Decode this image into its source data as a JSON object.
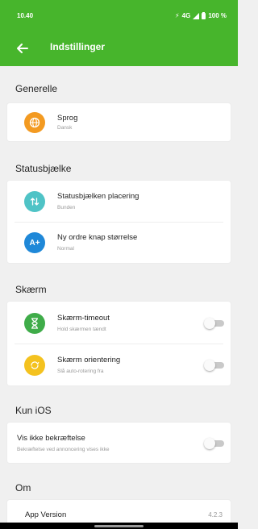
{
  "status_bar": {
    "time": "10.40",
    "network": "4G",
    "battery": "100 %"
  },
  "header": {
    "title": "Indstillinger",
    "back_icon": "arrow-left-icon",
    "color": "#47b52c"
  },
  "sections": {
    "general": {
      "title": "Generelle",
      "items": [
        {
          "label": "Sprog",
          "value": "Dansk",
          "icon": "globe-icon",
          "icon_color": "#f39a21"
        }
      ]
    },
    "statusbar": {
      "title": "Statusbjælke",
      "items": [
        {
          "label": "Statusbjælken placering",
          "value": "Bunden",
          "icon": "swap-vertical-icon",
          "icon_color": "#4fc3c6"
        },
        {
          "label": "Ny ordre knap størrelse",
          "value": "Normal",
          "icon": "font-size-increase-icon",
          "icon_color": "#1f88d8"
        }
      ]
    },
    "screen": {
      "title": "Skærm",
      "items": [
        {
          "label": "Skærm-timeout",
          "value": "Hold skærmen tændt",
          "icon": "hourglass-icon",
          "icon_color": "#3fac49",
          "toggle": false
        },
        {
          "label": "Skærm orientering",
          "value": "Slå auto-rotering fra",
          "icon": "rotate-screen-icon",
          "icon_color": "#f4c21f",
          "toggle": false
        }
      ]
    },
    "ios": {
      "title": "Kun iOS",
      "items": [
        {
          "label": "Vis ikke bekræftelse",
          "value": "Bekræftelse ved annoncering vises ikke",
          "toggle": false
        }
      ]
    },
    "about": {
      "title": "Om",
      "items": [
        {
          "label": "App Version",
          "value": "4.2.3"
        }
      ]
    }
  }
}
